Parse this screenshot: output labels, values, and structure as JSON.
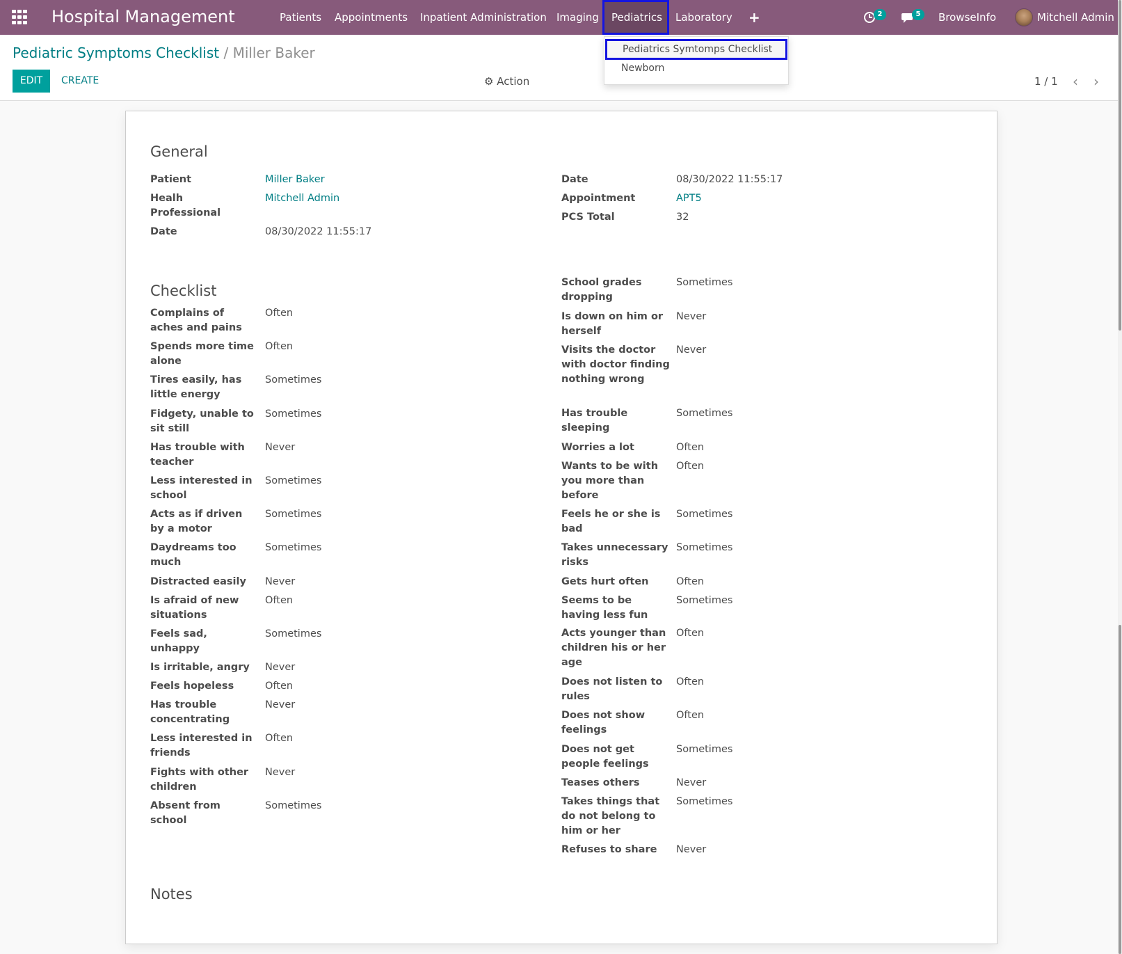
{
  "navbar": {
    "brand": "Hospital Management",
    "menu": [
      "Patients",
      "Appointments",
      "Inpatient Administration",
      "Imaging",
      "Pediatrics",
      "Laboratory"
    ],
    "activities_count": "2",
    "messages_count": "5",
    "company": "BrowseInfo",
    "user": "Mitchell Admin"
  },
  "dropdown": {
    "items": [
      "Pediatrics Symtomps Checklist",
      "Newborn"
    ]
  },
  "control": {
    "breadcrumb_parent": "Pediatric Symptoms Checklist",
    "breadcrumb_sep": "/",
    "breadcrumb_current": "Miller Baker",
    "edit": "EDIT",
    "create": "CREATE",
    "action": "Action",
    "pager": "1 / 1"
  },
  "general": {
    "title": "General",
    "left": [
      {
        "label": "Patient",
        "value": "Miller Baker"
      },
      {
        "label": "Healh Professional",
        "value": "Mitchell Admin"
      },
      {
        "label": "Date",
        "value": "08/30/2022 11:55:17"
      }
    ],
    "right": [
      {
        "label": "Date",
        "value": "08/30/2022 11:55:17"
      },
      {
        "label": "Appointment",
        "value": "APT5"
      },
      {
        "label": "PCS Total",
        "value": "32"
      }
    ]
  },
  "checklist": {
    "title": "Checklist",
    "left": [
      {
        "label": "Complains of aches and pains",
        "value": "Often"
      },
      {
        "label": "Spends more time alone",
        "value": "Often"
      },
      {
        "label": "Tires easily, has little energy",
        "value": "Sometimes"
      },
      {
        "label": "Fidgety, unable to sit still",
        "value": "Sometimes"
      },
      {
        "label": "Has trouble with teacher",
        "value": "Never"
      },
      {
        "label": "Less interested in school",
        "value": "Sometimes"
      },
      {
        "label": "Acts as if driven by a motor",
        "value": "Sometimes"
      },
      {
        "label": "Daydreams too much",
        "value": "Sometimes"
      },
      {
        "label": "Distracted easily",
        "value": "Never"
      },
      {
        "label": "Is afraid of new situations",
        "value": "Often"
      },
      {
        "label": "Feels sad, unhappy",
        "value": "Sometimes"
      },
      {
        "label": "Is irritable, angry",
        "value": "Never"
      },
      {
        "label": "Feels hopeless",
        "value": "Often"
      },
      {
        "label": "Has trouble concentrating",
        "value": "Never"
      },
      {
        "label": "Less interested in friends",
        "value": "Often"
      },
      {
        "label": "Fights with other children",
        "value": "Never"
      },
      {
        "label": "Absent from school",
        "value": "Sometimes"
      }
    ],
    "right": [
      {
        "label": "School grades dropping",
        "value": "Sometimes"
      },
      {
        "label": "Is down on him or herself",
        "value": "Never"
      },
      {
        "label": "Visits the doctor with doctor finding nothing wrong",
        "value": "Never"
      },
      {
        "label": "Has trouble sleeping",
        "value": "Sometimes"
      },
      {
        "label": "Worries a lot",
        "value": "Often"
      },
      {
        "label": "Wants to be with you more than before",
        "value": "Often"
      },
      {
        "label": "Feels he or she is bad",
        "value": "Sometimes"
      },
      {
        "label": "Takes unnecessary risks",
        "value": "Sometimes"
      },
      {
        "label": "Gets hurt often",
        "value": "Often"
      },
      {
        "label": "Seems to be having less fun",
        "value": "Sometimes"
      },
      {
        "label": "Acts younger than children his or her age",
        "value": "Often"
      },
      {
        "label": "Does not listen to rules",
        "value": "Often"
      },
      {
        "label": "Does not show feelings",
        "value": "Often"
      },
      {
        "label": "Does not get people feelings",
        "value": "Sometimes"
      },
      {
        "label": "Teases others",
        "value": "Never"
      },
      {
        "label": "Takes things that do not belong to him or her",
        "value": "Sometimes"
      },
      {
        "label": "Refuses to share",
        "value": "Never"
      }
    ]
  },
  "notes": {
    "title": "Notes"
  }
}
